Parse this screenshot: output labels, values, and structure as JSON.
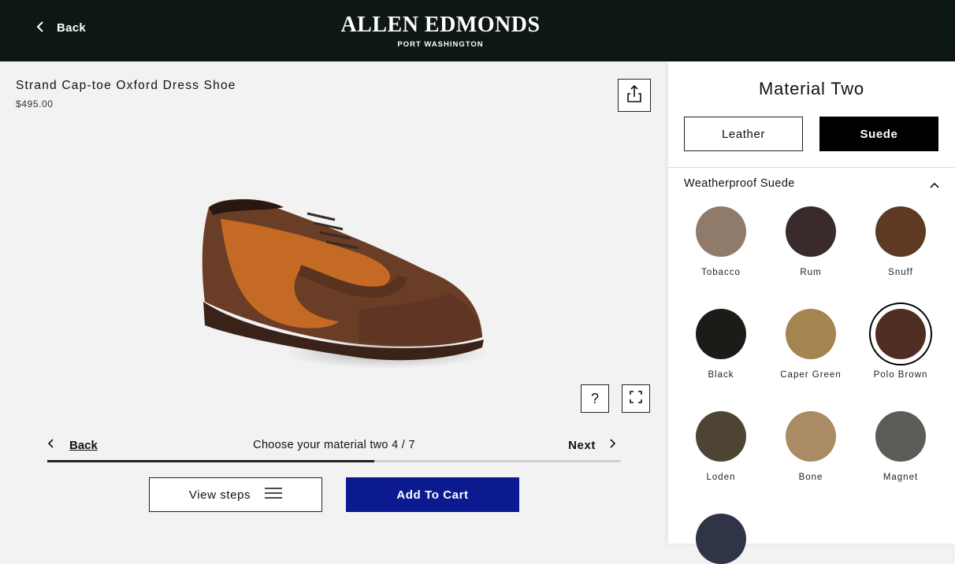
{
  "header": {
    "back_label": "Back",
    "brand_name": "ALLEN EDMONDS",
    "brand_sub": "PORT WASHINGTON"
  },
  "product": {
    "title": "Strand Cap-toe Oxford Dress Shoe",
    "price": "$495.00"
  },
  "viewer": {
    "help_label": "?"
  },
  "steps": {
    "back_label": "Back",
    "current": "Choose your material two 4 / 7",
    "next_label": "Next",
    "progress": 0.57
  },
  "actions": {
    "view_steps_label": "View steps",
    "add_to_cart_label": "Add To Cart",
    "add_to_cart_color": "#0b1a8e"
  },
  "panel": {
    "title": "Material Two",
    "materials": [
      "Leather",
      "Suede"
    ],
    "selected_material": "Suede",
    "section_label": "Weatherproof Suede",
    "swatches": [
      {
        "name": "Tobacco",
        "color": "#907a6a"
      },
      {
        "name": "Rum",
        "color": "#392b2b"
      },
      {
        "name": "Snuff",
        "color": "#5e3a22"
      },
      {
        "name": "Black",
        "color": "#1b1c18"
      },
      {
        "name": "Caper Green",
        "color": "#a4844f"
      },
      {
        "name": "Polo Brown",
        "color": "#4f2d22",
        "selected": true
      },
      {
        "name": "Loden",
        "color": "#4e4434"
      },
      {
        "name": "Bone",
        "color": "#ab8b63"
      },
      {
        "name": "Magnet",
        "color": "#5c5c56"
      },
      {
        "name": "",
        "color": "#2f3447"
      }
    ]
  }
}
